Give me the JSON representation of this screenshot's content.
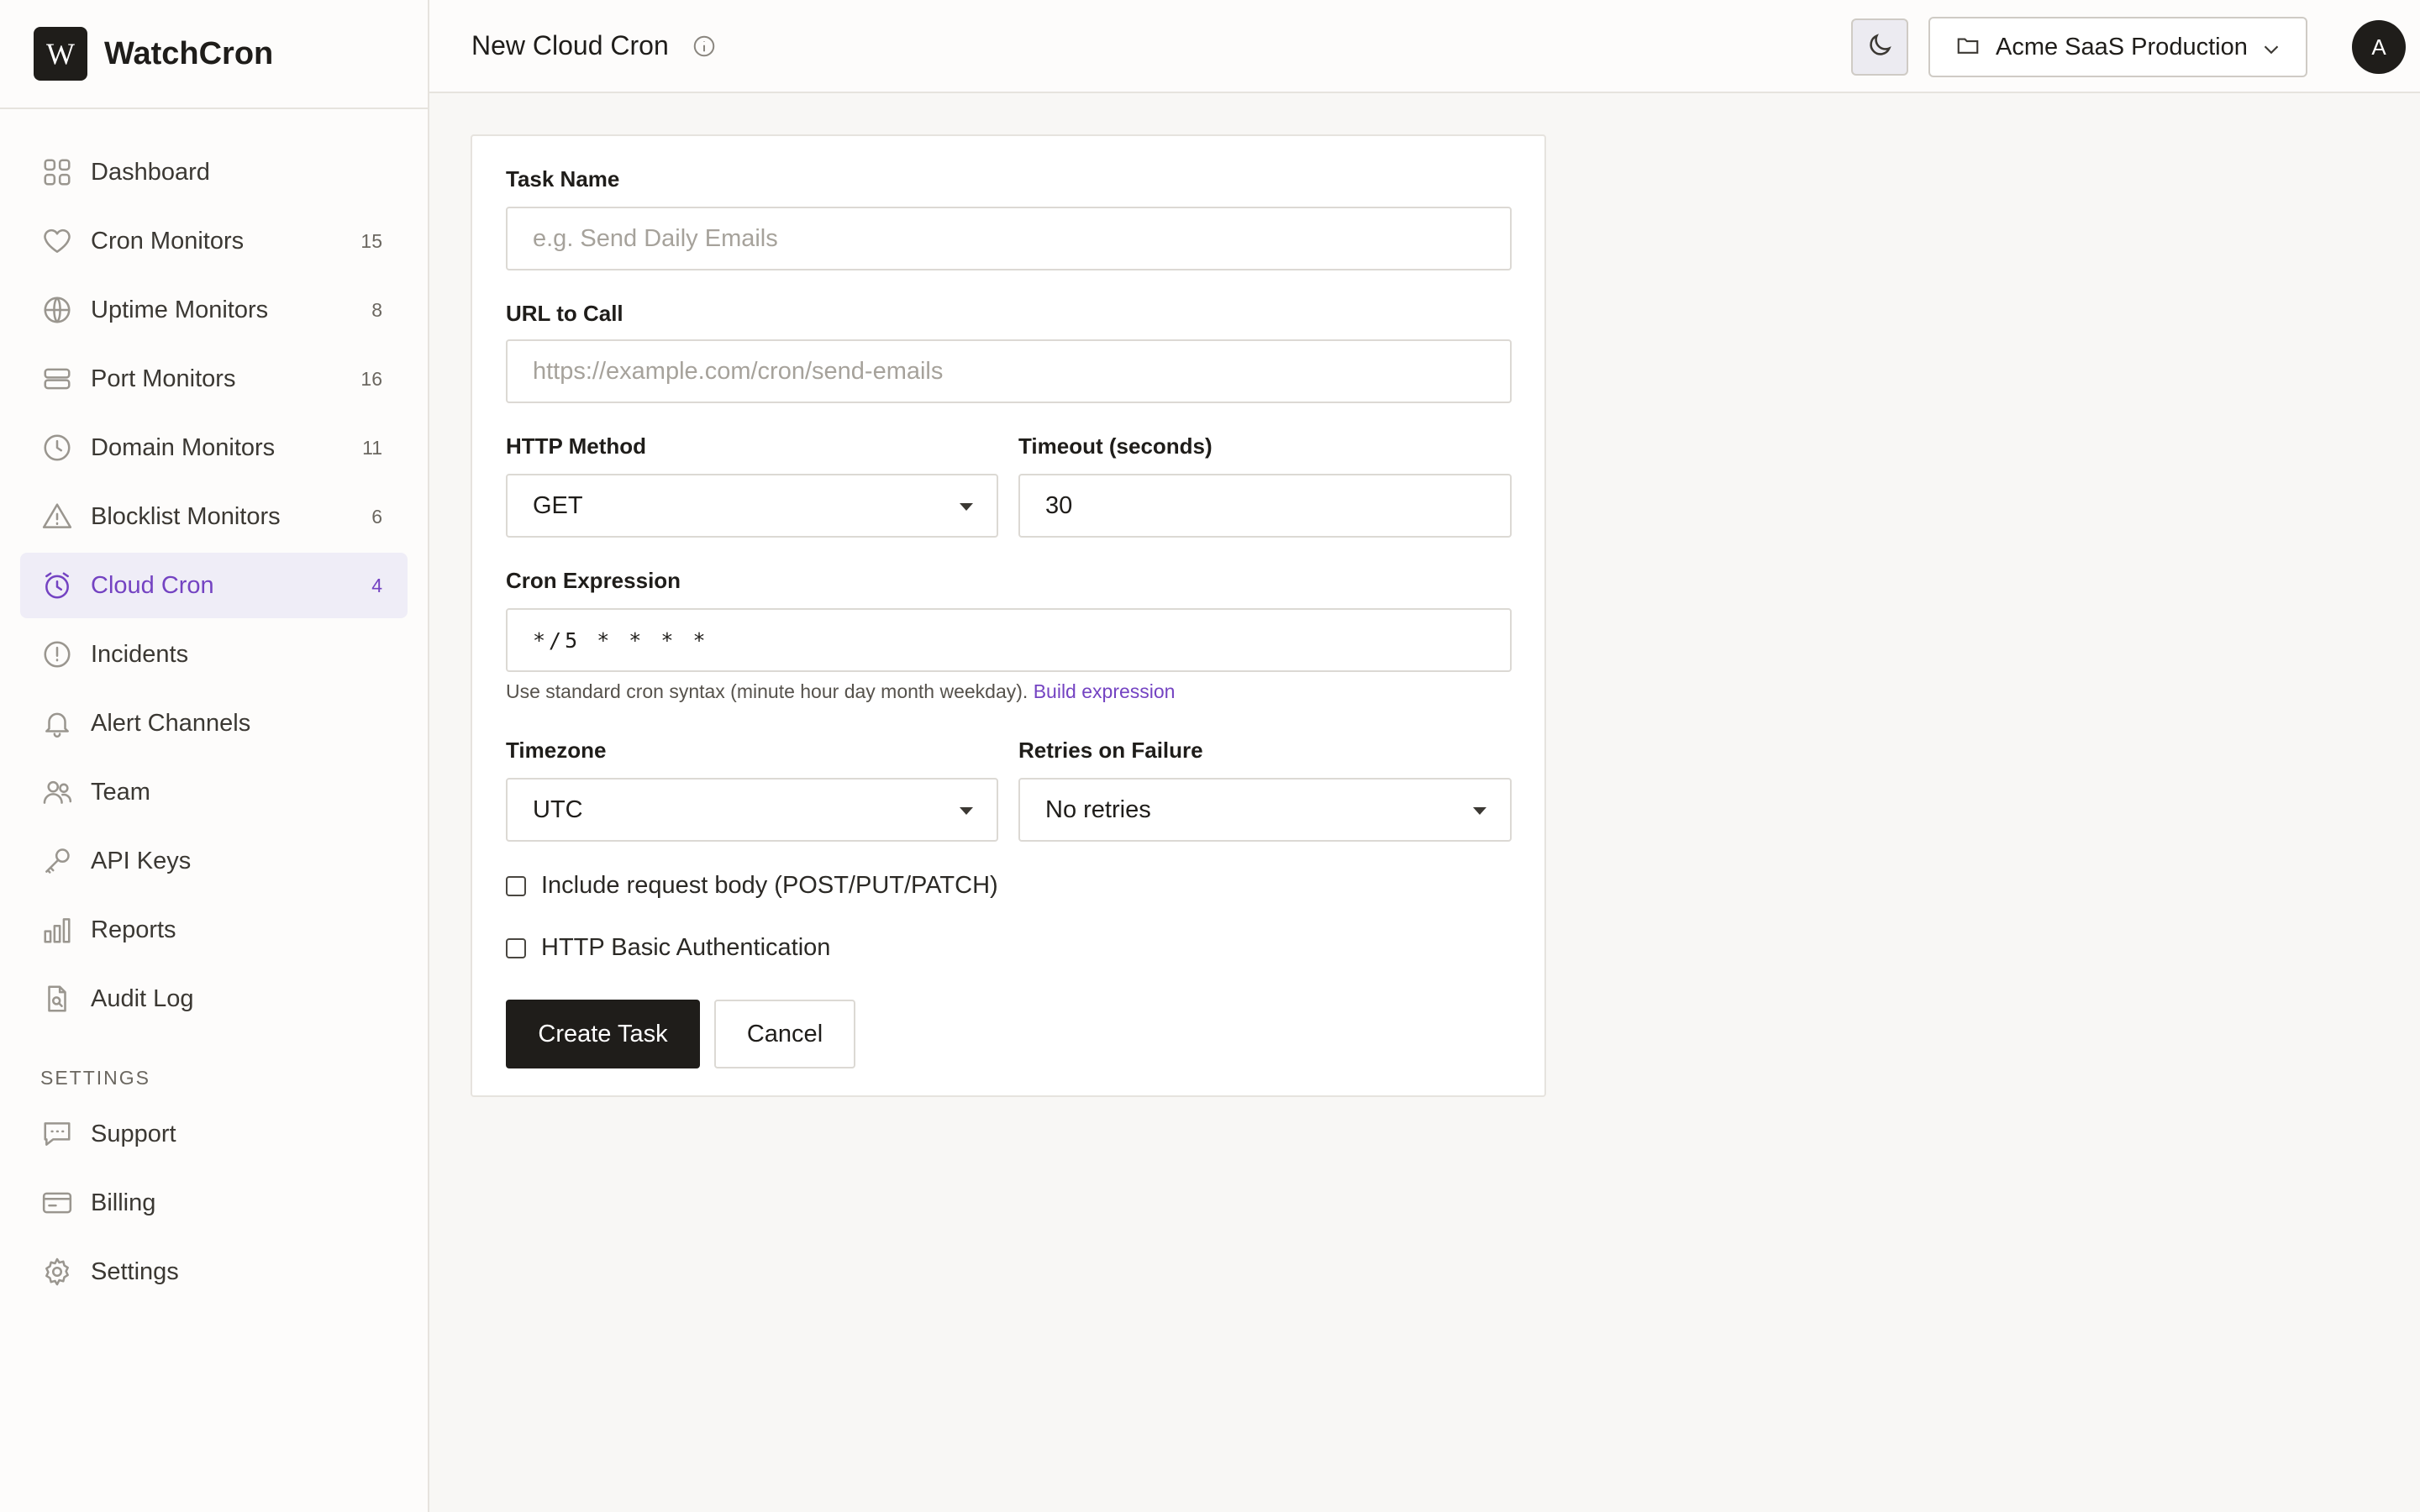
{
  "app": {
    "logo_letter": "W",
    "name": "WatchCron"
  },
  "sidebar": {
    "items": [
      {
        "label": "Dashboard",
        "count": "",
        "icon": "grid-icon"
      },
      {
        "label": "Cron Monitors",
        "count": "15",
        "icon": "heart-icon"
      },
      {
        "label": "Uptime Monitors",
        "count": "8",
        "icon": "globe-icon"
      },
      {
        "label": "Port Monitors",
        "count": "16",
        "icon": "server-icon"
      },
      {
        "label": "Domain Monitors",
        "count": "11",
        "icon": "clock-icon"
      },
      {
        "label": "Blocklist Monitors",
        "count": "6",
        "icon": "warning-icon"
      },
      {
        "label": "Cloud Cron",
        "count": "4",
        "icon": "alarm-clock-icon",
        "active": true
      },
      {
        "label": "Incidents",
        "count": "",
        "icon": "alert-circle-icon"
      },
      {
        "label": "Alert Channels",
        "count": "",
        "icon": "bell-icon"
      },
      {
        "label": "Team",
        "count": "",
        "icon": "users-icon"
      },
      {
        "label": "API Keys",
        "count": "",
        "icon": "key-icon"
      },
      {
        "label": "Reports",
        "count": "",
        "icon": "bar-chart-icon"
      },
      {
        "label": "Audit Log",
        "count": "",
        "icon": "file-search-icon"
      }
    ],
    "settings_label": "SETTINGS",
    "settings_items": [
      {
        "label": "Support",
        "icon": "chat-icon"
      },
      {
        "label": "Billing",
        "icon": "credit-card-icon"
      },
      {
        "label": "Settings",
        "icon": "gear-icon"
      }
    ]
  },
  "header": {
    "title": "New Cloud Cron",
    "project": "Acme SaaS Production",
    "avatar_initial": "A"
  },
  "form": {
    "task_name": {
      "label": "Task Name",
      "placeholder": "e.g. Send Daily Emails",
      "value": ""
    },
    "url": {
      "label": "URL to Call",
      "placeholder": "https://example.com/cron/send-emails",
      "value": ""
    },
    "method": {
      "label": "HTTP Method",
      "value": "GET"
    },
    "timeout": {
      "label": "Timeout (seconds)",
      "value": "30"
    },
    "cron": {
      "label": "Cron Expression",
      "value": "*/5 * * * *",
      "helper": "Use standard cron syntax (minute hour day month weekday).",
      "helper_link": "Build expression"
    },
    "timezone": {
      "label": "Timezone",
      "value": "UTC"
    },
    "retries": {
      "label": "Retries on Failure",
      "value": "No retries"
    },
    "include_body": {
      "label": "Include request body (POST/PUT/PATCH)",
      "checked": false
    },
    "basic_auth": {
      "label": "HTTP Basic Authentication",
      "checked": false
    },
    "submit_label": "Create Task",
    "cancel_label": "Cancel"
  },
  "colors": {
    "accent": "#7443c2",
    "primary": "#1f1d1a",
    "active_bg": "#efedf7"
  }
}
